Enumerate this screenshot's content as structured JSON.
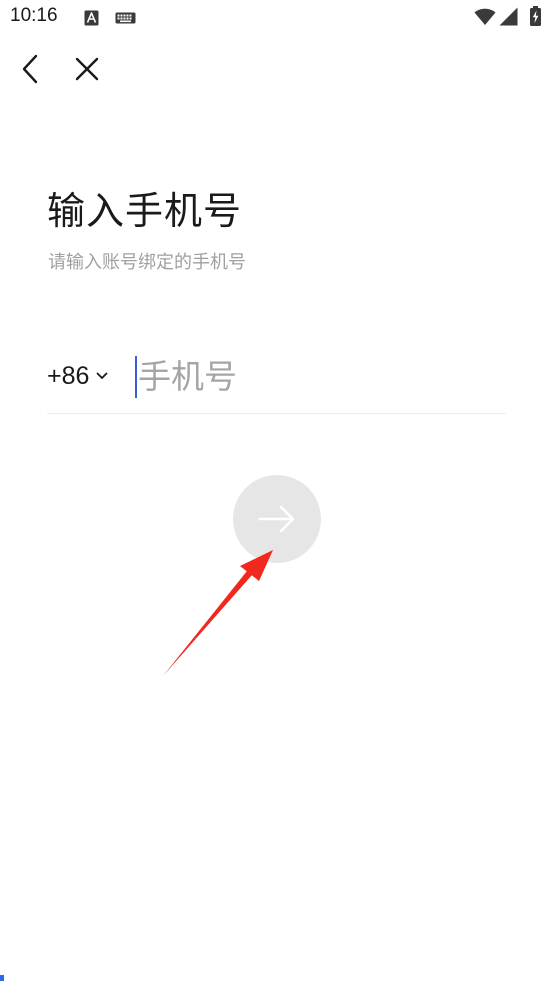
{
  "status_bar": {
    "time": "10:16",
    "icons": [
      "text-input-icon",
      "keyboard-icon",
      "wifi-icon",
      "signal-icon",
      "battery-charging-icon"
    ]
  },
  "nav": {
    "back_icon": "chevron-left-icon",
    "close_icon": "close-icon"
  },
  "header": {
    "title": "输入手机号",
    "subtitle": "请输入账号绑定的手机号"
  },
  "phone": {
    "country_code": "+86",
    "placeholder": "手机号",
    "value": ""
  },
  "next_button": {
    "icon": "arrow-right-icon",
    "enabled": false
  },
  "colors": {
    "text_primary": "#1a1a1a",
    "text_secondary": "#a0a0a0",
    "placeholder": "#a5a5a5",
    "caret": "#3b5bdb",
    "divider": "#ececec",
    "button_disabled": "#e6e6e6",
    "annotation_arrow": "#f0281e"
  }
}
